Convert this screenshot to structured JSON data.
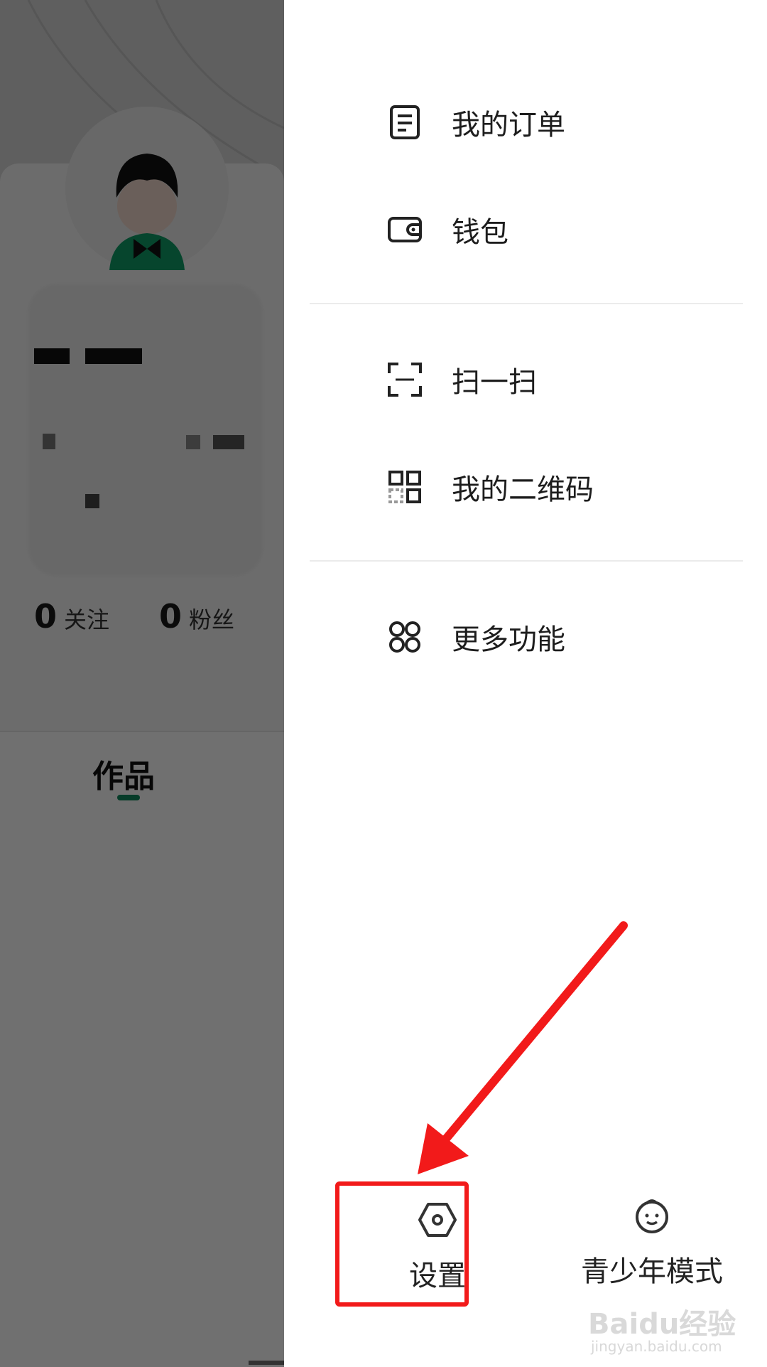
{
  "profile": {
    "following_count": "0",
    "following_label": "关注",
    "followers_count": "0",
    "followers_label": "粉丝",
    "tab_works": "作品"
  },
  "drawer": {
    "menu": [
      {
        "label": "我的订单",
        "icon": "order-icon"
      },
      {
        "label": "钱包",
        "icon": "wallet-icon"
      },
      {
        "label": "扫一扫",
        "icon": "scan-icon"
      },
      {
        "label": "我的二维码",
        "icon": "qrcode-icon"
      },
      {
        "label": "更多功能",
        "icon": "more-functions-icon"
      }
    ],
    "bottom": {
      "settings_label": "设置",
      "youth_mode_label": "青少年模式"
    }
  },
  "annotation": {
    "color": "#f21a1a"
  },
  "watermark": {
    "logo": "Baidu经验",
    "url": "jingyan.baidu.com"
  }
}
